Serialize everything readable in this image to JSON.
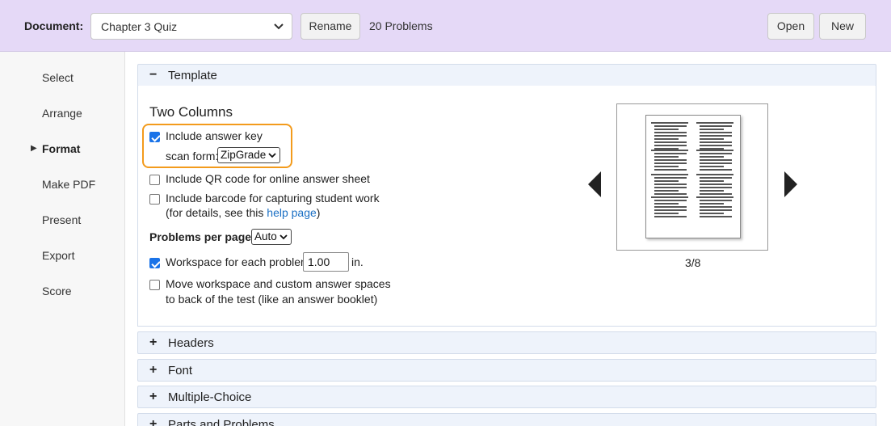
{
  "header": {
    "document_label": "Document:",
    "document_value": "Chapter 3 Quiz",
    "rename_label": "Rename",
    "problem_count": "20 Problems",
    "open_label": "Open",
    "new_label": "New"
  },
  "sidebar": {
    "items": [
      {
        "label": "Select"
      },
      {
        "label": "Arrange"
      },
      {
        "label": "Format",
        "active": true
      },
      {
        "label": "Make PDF"
      },
      {
        "label": "Present"
      },
      {
        "label": "Export"
      },
      {
        "label": "Score"
      }
    ]
  },
  "panels": {
    "template": {
      "symbol": "−",
      "title": "Template"
    },
    "headers": {
      "symbol": "+",
      "title": "Headers"
    },
    "font": {
      "symbol": "+",
      "title": "Font"
    },
    "multiple_choice": {
      "symbol": "+",
      "title": "Multiple-Choice"
    },
    "parts": {
      "symbol": "+",
      "title": "Parts and Problems"
    }
  },
  "template": {
    "layout_name": "Two Columns",
    "answer_key": {
      "label": "Include answer key",
      "checked": true
    },
    "scan_form": {
      "label": "scan form:",
      "value": "ZipGrade"
    },
    "qr_code": {
      "label": "Include QR code for online answer sheet",
      "checked": false
    },
    "barcode": {
      "label": "Include barcode for capturing student work",
      "checked": false
    },
    "barcode_note_prefix": "(for details, see this ",
    "barcode_note_link": "help page",
    "barcode_note_suffix": ")",
    "problems_per_page": {
      "label": "Problems per page:",
      "value": "Auto"
    },
    "workspace": {
      "label": "Workspace for each problem",
      "value": "1.00",
      "unit": "in.",
      "checked": true
    },
    "move_workspace": {
      "label_line1": "Move workspace and custom answer spaces",
      "label_line2": "to back of the test (like an answer booklet)",
      "checked": false
    },
    "preview_page": "3/8"
  },
  "colors": {
    "header_bg": "#e5d9f7",
    "highlight": "#f39b1c",
    "link": "#1a6fc4",
    "checkbox": "#1a73e8"
  },
  "icons": {
    "select_arrow": "chevron-down-icon",
    "prev": "triangle-left-icon",
    "next": "triangle-right-icon",
    "active_marker": "triangle-right-small-icon"
  }
}
